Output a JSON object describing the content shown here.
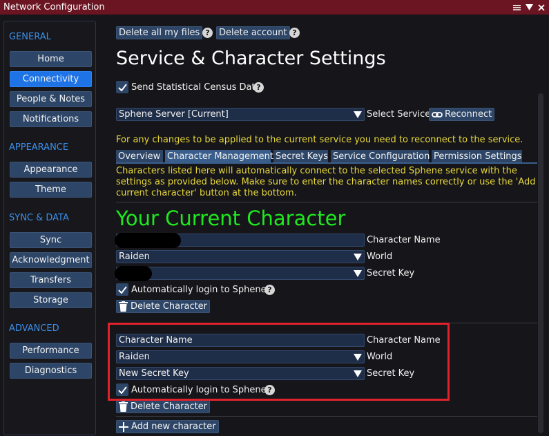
{
  "window": {
    "title": "Network Configuration",
    "controls": [
      "menu-icon",
      "collapse-icon",
      "close-icon"
    ]
  },
  "sidebar": {
    "sections": [
      {
        "label": "GENERAL",
        "items": [
          "Home",
          "Connectivity",
          "People & Notes",
          "Notifications"
        ]
      },
      {
        "label": "APPEARANCE",
        "items": [
          "Appearance",
          "Theme"
        ]
      },
      {
        "label": "SYNC & DATA",
        "items": [
          "Sync",
          "Acknowledgment",
          "Transfers",
          "Storage"
        ]
      },
      {
        "label": "ADVANCED",
        "items": [
          "Performance",
          "Diagnostics"
        ]
      }
    ],
    "active_item": "Connectivity"
  },
  "top_actions": {
    "delete_files": "Delete all my files",
    "delete_account": "Delete account",
    "help": "?"
  },
  "page": {
    "heading": "Service & Character Settings",
    "census_label": "Send Statistical Census Data",
    "census_checked": true
  },
  "service": {
    "selected": "Sphene Server [Current]",
    "label": "Select Service",
    "reconnect": "Reconnect"
  },
  "notice": "For any changes to be applied to the current service you need to reconnect to the service.",
  "tabs": {
    "overview": "Overview",
    "character_management": "Character Management",
    "secret_keys": "Secret Keys",
    "service_configuration": "Service Configuration",
    "permission_settings": "Permission Settings",
    "active": "Character Management"
  },
  "info_text": "Characters listed here will automatically connect to the selected Sphene service with the settings as provided below. Make sure to enter the character names correctly or use the 'Add current character' button at the bottom.",
  "current_character": {
    "heading": "Your Current Character",
    "name_value": "",
    "name_label": "Character Name",
    "world_value": "Raiden",
    "world_label": "World",
    "key_value": "",
    "key_label": "Secret Key",
    "auto_login_label": "Automatically login to Sphene",
    "auto_login_checked": true,
    "delete_label": "Delete Character"
  },
  "new_character": {
    "name_value": "Character Name",
    "name_label": "Character Name",
    "world_value": "Raiden",
    "world_label": "World",
    "key_value": "New Secret Key",
    "key_label": "Secret Key",
    "auto_login_label": "Automatically login to Sphene",
    "auto_login_checked": true,
    "delete_label": "Delete Character"
  },
  "add_character": "Add new character",
  "colors": {
    "titlebar": "#6b1523",
    "accent": "#1e73e6",
    "section_label": "#3d8fe8",
    "notice_text": "#e8d83a",
    "current_heading": "#1fe81f",
    "highlight_border": "#e0222d"
  }
}
